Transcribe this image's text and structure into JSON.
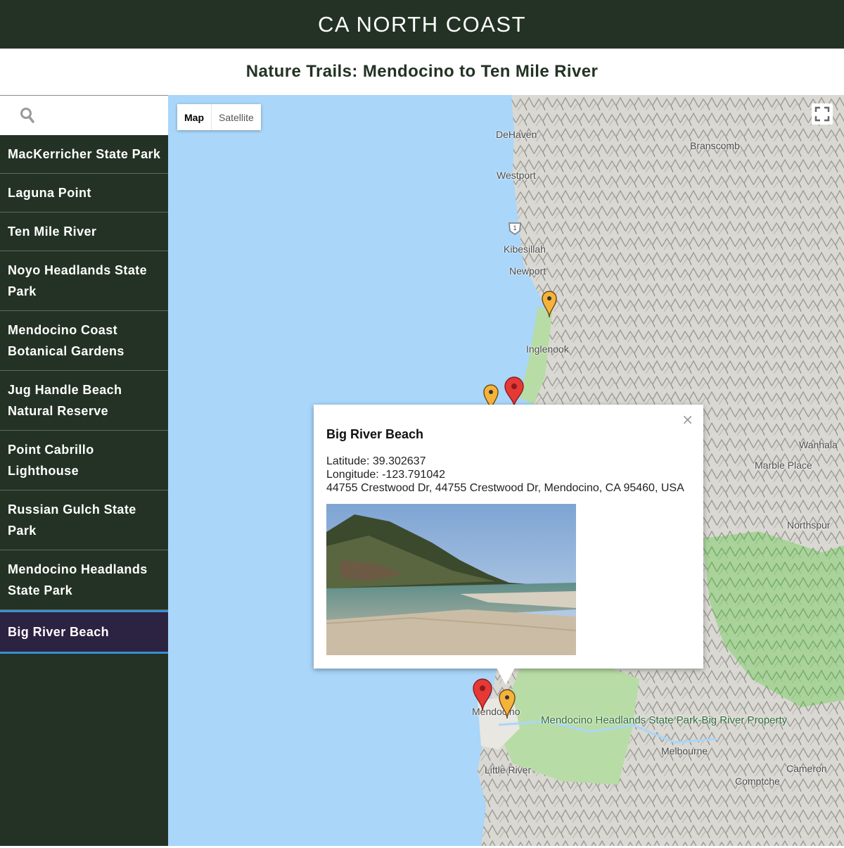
{
  "header": {
    "title": "CA NORTH COAST"
  },
  "subheader": {
    "title": "Nature Trails: Mendocino to Ten Mile River"
  },
  "search": {
    "icon": "search-icon",
    "value": ""
  },
  "trails": [
    {
      "label": "MacKerricher State Park"
    },
    {
      "label": "Laguna Point"
    },
    {
      "label": "Ten Mile River"
    },
    {
      "label": "Noyo Headlands State Park"
    },
    {
      "label": "Mendocino Coast Botanical Gardens"
    },
    {
      "label": "Jug Handle Beach Natural Reserve"
    },
    {
      "label": "Point Cabrillo Lighthouse"
    },
    {
      "label": "Russian Gulch State Park"
    },
    {
      "label": "Mendocino Headlands State Park"
    },
    {
      "label": "Big River Beach",
      "selected": true
    }
  ],
  "map": {
    "type_controls": {
      "map": "Map",
      "satellite": "Satellite",
      "active": "Map"
    },
    "fullscreen_icon": "fullscreen-icon",
    "route_shield": "1",
    "places": {
      "dehaven": "DeHaven",
      "branscomb": "Branscomb",
      "westport": "Westport",
      "kibesillah": "Kibesillah",
      "newport": "Newport",
      "inglenook": "Inglenook",
      "wanhala": "Wanhala",
      "marble_place": "Marble Place",
      "northspur": "Northspur",
      "mendocino": "Mendocino",
      "headlands_park": "Mendocino Headlands State Park-Big River Property",
      "melbourne": "Melbourne",
      "cameron": "Cameron",
      "comptche": "Comptche",
      "little_river": "Little River"
    },
    "colors": {
      "water": "#a9d6f9",
      "pin_default": "#f6b33b",
      "pin_selected": "#e53935",
      "park": "#b8dca5"
    }
  },
  "info_window": {
    "title": "Big River Beach",
    "latitude": "Latitude: 39.302637",
    "longitude": "Longitude: -123.791042",
    "address": "44755 Crestwood Dr, 44755 Crestwood Dr, Mendocino, CA 95460, USA",
    "close_icon": "close-icon",
    "close_glyph": "×",
    "photo": "beach-photo"
  }
}
